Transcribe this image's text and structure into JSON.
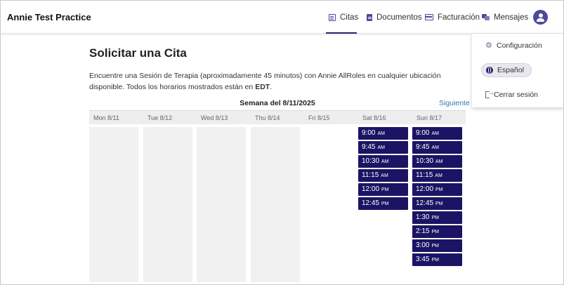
{
  "header": {
    "brand": "Annie Test Practice",
    "nav": [
      {
        "label": "Citas",
        "icon": "calendar-icon",
        "active": true
      },
      {
        "label": "Documentos",
        "icon": "document-icon"
      },
      {
        "label": "Facturación",
        "icon": "credit-card-icon"
      },
      {
        "label": "Mensajes",
        "icon": "messages-icon"
      }
    ],
    "avatar_icon": "user-icon"
  },
  "menu": {
    "items": [
      {
        "label": "Configuración",
        "icon": "gear-icon"
      },
      {
        "label": "Español",
        "icon": "globe-icon"
      },
      {
        "label": "Cerrar sesión",
        "icon": "logout-icon"
      }
    ]
  },
  "main": {
    "title": "Solicitar una Cita",
    "intro_text": "Encuentre una Sesión de Terapia (aproximadamente 45 minutos) con Annie AllRoles en cualquier ubicación disponible. Todos los horarios mostrados están en",
    "intro_tz": "EDT",
    "intro_end": ".",
    "week_label": "Semana del 8/11/2025",
    "next_label": "Siguiente"
  },
  "days": [
    {
      "label": "Mon 8/11",
      "slots": []
    },
    {
      "label": "Tue 8/12",
      "slots": []
    },
    {
      "label": "Wed 8/13",
      "slots": []
    },
    {
      "label": "Thu 8/14",
      "slots": []
    },
    {
      "label": "Fri 8/15",
      "slots": []
    },
    {
      "label": "Sat 8/16",
      "slots": [
        {
          "time": "9:00",
          "ampm": "AM"
        },
        {
          "time": "9:45",
          "ampm": "AM"
        },
        {
          "time": "10:30",
          "ampm": "AM"
        },
        {
          "time": "11:15",
          "ampm": "AM"
        },
        {
          "time": "12:00",
          "ampm": "PM"
        },
        {
          "time": "12:45",
          "ampm": "PM"
        }
      ]
    },
    {
      "label": "Sun 8/17",
      "slots": [
        {
          "time": "9:00",
          "ampm": "AM"
        },
        {
          "time": "9:45",
          "ampm": "AM"
        },
        {
          "time": "10:30",
          "ampm": "AM"
        },
        {
          "time": "11:15",
          "ampm": "AM"
        },
        {
          "time": "12:00",
          "ampm": "PM"
        },
        {
          "time": "12:45",
          "ampm": "PM"
        },
        {
          "time": "1:30",
          "ampm": "PM"
        },
        {
          "time": "2:15",
          "ampm": "PM"
        },
        {
          "time": "3:00",
          "ampm": "PM"
        },
        {
          "time": "3:45",
          "ampm": "PM"
        }
      ]
    }
  ],
  "colors": {
    "accent": "#1b1464",
    "link": "#2a7ab8",
    "unavailable": "#f1f1f1"
  }
}
